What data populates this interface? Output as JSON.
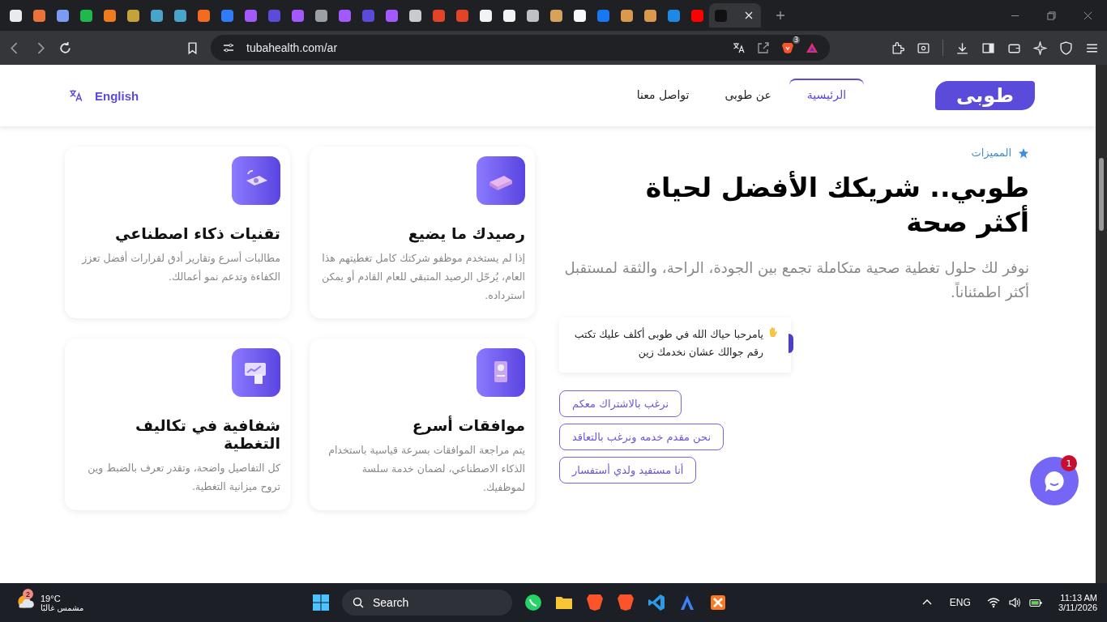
{
  "browser": {
    "tabs": [
      {
        "color": "#e8eaed",
        "selected": false
      },
      {
        "color": "#e8743b",
        "selected": false
      },
      {
        "color": "#7b9cf0",
        "selected": false
      },
      {
        "color": "#1fb84a",
        "selected": false
      },
      {
        "color": "#f07b1d",
        "selected": false
      },
      {
        "color": "#c6a23a",
        "selected": false
      },
      {
        "color": "#4aa3c8",
        "selected": false
      },
      {
        "color": "#4aa3c8",
        "selected": false
      },
      {
        "color": "#f26b21",
        "selected": false
      },
      {
        "color": "#2f7cf6",
        "selected": false
      },
      {
        "color": "#a259ff",
        "selected": false
      },
      {
        "color": "#5b4bdb",
        "selected": false
      },
      {
        "color": "#a259ff",
        "selected": false
      },
      {
        "color": "#9aa0a6",
        "selected": false
      },
      {
        "color": "#a259ff",
        "selected": false
      },
      {
        "color": "#5b4bdb",
        "selected": false
      },
      {
        "color": "#a259ff",
        "selected": false
      },
      {
        "color": "#c8cacd",
        "selected": false
      },
      {
        "color": "#e24329",
        "selected": false
      },
      {
        "color": "#e24329",
        "selected": false
      },
      {
        "color": "#f1f3f4",
        "selected": false
      },
      {
        "color": "#f1f3f4",
        "selected": false
      },
      {
        "color": "#bdc1c6",
        "selected": false
      },
      {
        "color": "#d6a35c",
        "selected": false
      },
      {
        "color": "#f8f9fa",
        "selected": false
      },
      {
        "color": "#1877f2",
        "selected": false
      },
      {
        "color": "#d99a4e",
        "selected": false
      },
      {
        "color": "#d99a4e",
        "selected": false
      },
      {
        "color": "#1e88e5",
        "selected": false
      },
      {
        "color": "#ff0000",
        "selected": false
      },
      {
        "color": "#111111",
        "selected": true
      }
    ],
    "address": "tubahealth.com/ar",
    "shield_badge": "3"
  },
  "header": {
    "logo": "طوبى",
    "nav": [
      {
        "label": "الرئيسية",
        "selected": true
      },
      {
        "label": "عن طوبى",
        "selected": false
      },
      {
        "label": "تواصل معنا",
        "selected": false
      }
    ],
    "language": "English"
  },
  "hero": {
    "eyebrow": "المميزات",
    "title": "طوبي.. شريكك الأفضل لحياة أكثر صحة",
    "subtitle": "نوفر لك حلول تغطية صحية متكاملة تجمع بين الجودة، الراحة، والثقة لمستقبل أكثر اطمئناناً.",
    "chat_message": "يامرحبا حياك الله في طوبى أكلف عليك تكتب رقم جوالك عشان نخدمك زين",
    "options": [
      "نرغب بالاشتراك معكم",
      "نحن مقدم خدمه ونرغب بالتعاقد",
      "أنا مستفيد ولدي أستفسار"
    ]
  },
  "features": [
    {
      "title": "رصيدك ما يضيع",
      "text": "إذا لم يستخدم موظفو شركتك كامل تغطيتهم هذا العام، يُرحّل الرصيد المتبقي للعام القادم أو يمكن استرداده."
    },
    {
      "title": "تقنيات ذكاء اصطناعي",
      "text": "مطالبات أسرع وتقارير أدق لقرارات أفضل تعزز الكفاءة وتدعم نمو أعمالك."
    },
    {
      "title": "موافقات أسرع",
      "text": "يتم مراجعة الموافقات بسرعة قياسية باستخدام الذكاء الاصطناعي، لضمان خدمة سلسة لموظفيك."
    },
    {
      "title": "شفافية في تكاليف التغطية",
      "text": "كل التفاصيل واضحة، وتقدر تعرف بالضبط وين تروح ميزانية التغطية."
    }
  ],
  "chat_widget": {
    "badge": "1"
  },
  "taskbar": {
    "weather_badge": "2",
    "temperature": "19°C",
    "weather": "مشمس غالبًا",
    "search": "Search",
    "language": "ENG",
    "time": "11:13 AM",
    "date": "3/11/2026"
  }
}
